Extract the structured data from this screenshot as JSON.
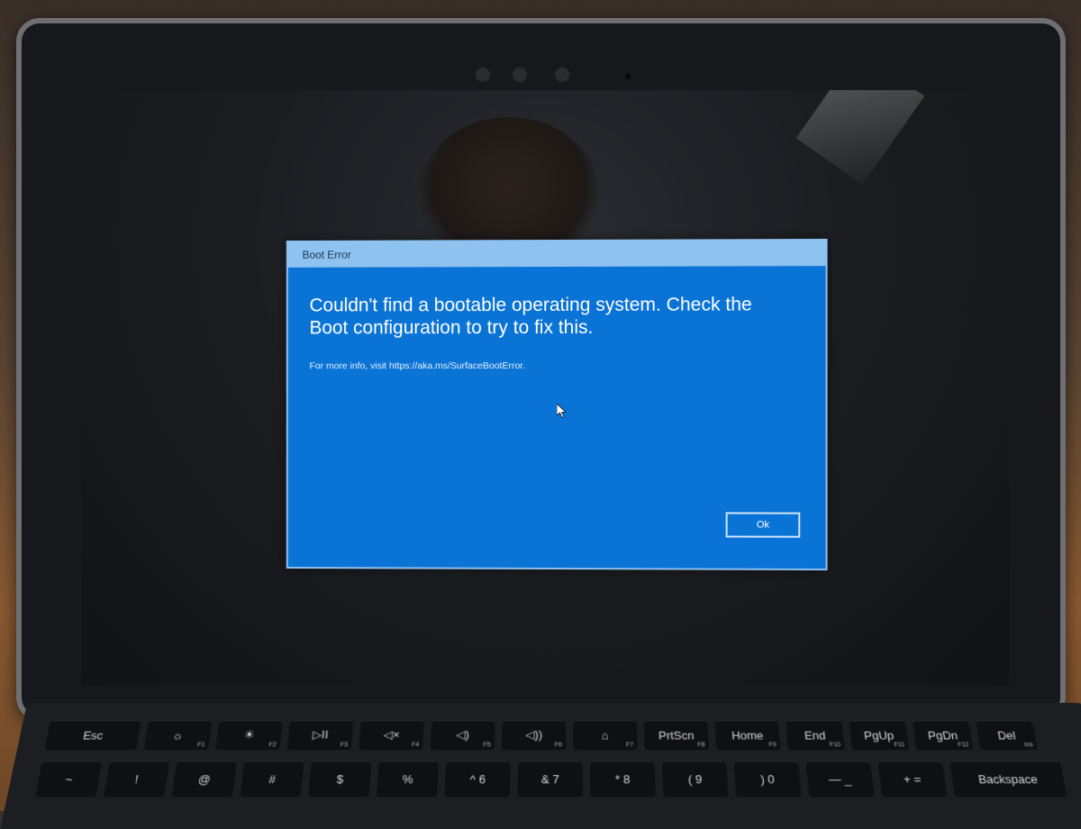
{
  "dialog": {
    "title": "Boot Error",
    "headline": "Couldn't find a bootable operating system. Check the Boot configuration to try to fix this.",
    "info": "For more info, visit https://aka.ms/SurfaceBootError.",
    "ok_label": "Ok",
    "accent_color": "#0a73d6"
  },
  "keyboard": {
    "row1": [
      {
        "label": "Esc",
        "sub": ""
      },
      {
        "label": "☼",
        "sub": "F1"
      },
      {
        "label": "☀",
        "sub": "F2"
      },
      {
        "label": "▷II",
        "sub": "F3"
      },
      {
        "label": "◁×",
        "sub": "F4"
      },
      {
        "label": "◁)",
        "sub": "F5"
      },
      {
        "label": "◁))",
        "sub": "F6"
      },
      {
        "label": "⌂",
        "sub": "F7"
      },
      {
        "label": "PrtScn",
        "sub": "F8"
      },
      {
        "label": "Home",
        "sub": "F9"
      },
      {
        "label": "End",
        "sub": "F10"
      },
      {
        "label": "PgUp",
        "sub": "F11"
      },
      {
        "label": "PgDn",
        "sub": "F12"
      },
      {
        "label": "Del",
        "sub": "Ins"
      }
    ],
    "row2": [
      {
        "label": "~"
      },
      {
        "label": "!"
      },
      {
        "label": "@"
      },
      {
        "label": "#"
      },
      {
        "label": "$"
      },
      {
        "label": "%"
      },
      {
        "label": "^ 6"
      },
      {
        "label": "& 7"
      },
      {
        "label": "* 8"
      },
      {
        "label": "( 9"
      },
      {
        "label": ") 0"
      },
      {
        "label": "— _"
      },
      {
        "label": "+ ="
      },
      {
        "label": "Backspace"
      }
    ]
  }
}
